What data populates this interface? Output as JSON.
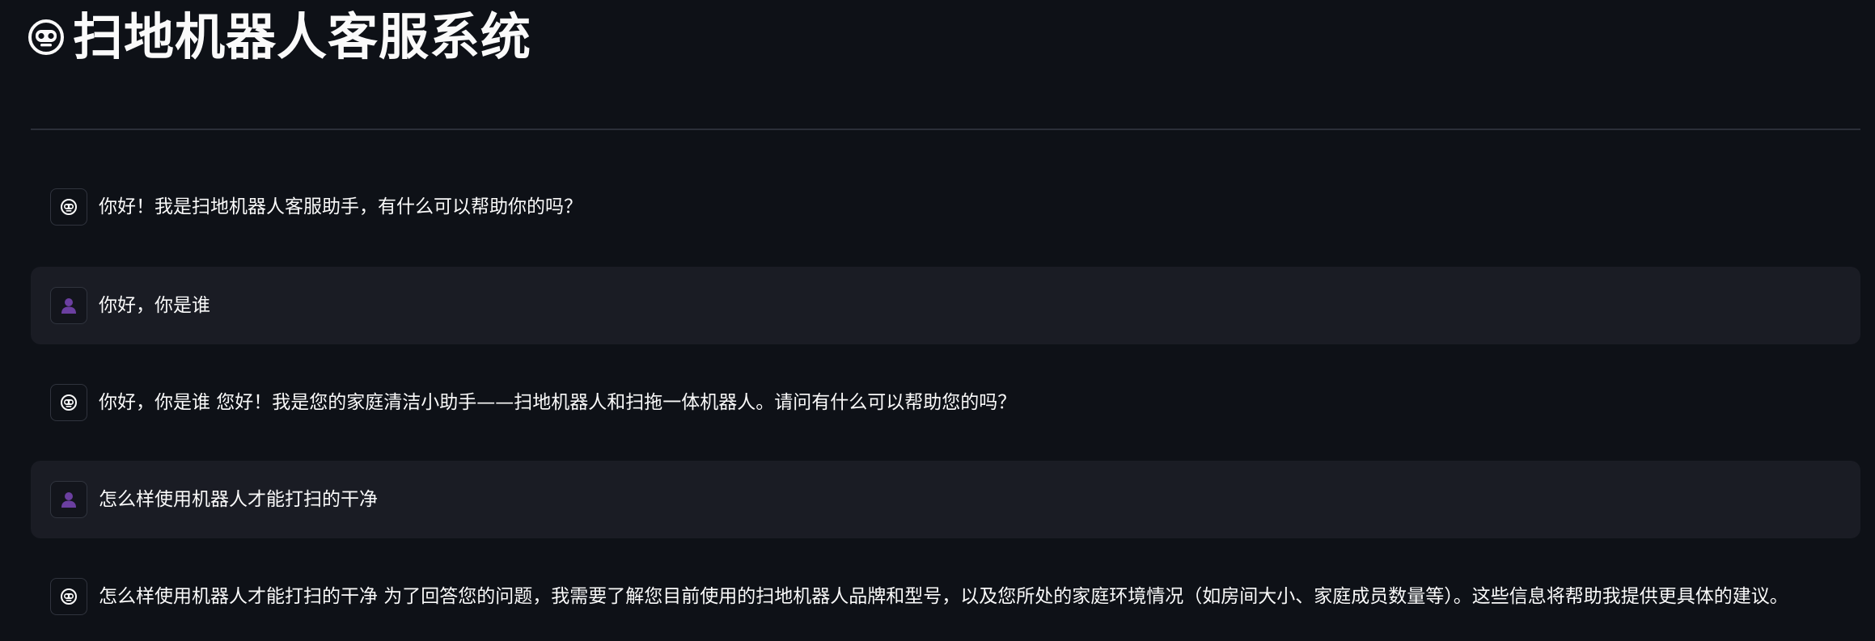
{
  "app": {
    "title": "扫地机器人客服系统",
    "title_icon": "robot-face-icon"
  },
  "colors": {
    "background": "#0e1117",
    "user_bubble": "#1a1c24",
    "divider": "#2b2f38",
    "text": "#fafafa",
    "user_avatar": "#6b3fa0"
  },
  "chat": {
    "messages": [
      {
        "role": "assistant",
        "avatar_icon": "robot-avatar-icon",
        "text": "你好！我是扫地机器人客服助手，有什么可以帮助你的吗？"
      },
      {
        "role": "user",
        "avatar_icon": "user-avatar-icon",
        "text": "你好，你是谁"
      },
      {
        "role": "assistant",
        "avatar_icon": "robot-avatar-icon",
        "text": "你好，你是谁 您好！我是您的家庭清洁小助手——扫地机器人和扫拖一体机器人。请问有什么可以帮助您的吗？"
      },
      {
        "role": "user",
        "avatar_icon": "user-avatar-icon",
        "text": "怎么样使用机器人才能打扫的干净"
      },
      {
        "role": "assistant",
        "avatar_icon": "robot-avatar-icon",
        "text": "怎么样使用机器人才能打扫的干净 为了回答您的问题，我需要了解您目前使用的扫地机器人品牌和型号，以及您所处的家庭环境情况（如房间大小、家庭成员数量等）。这些信息将帮助我提供更具体的建议。"
      }
    ]
  }
}
